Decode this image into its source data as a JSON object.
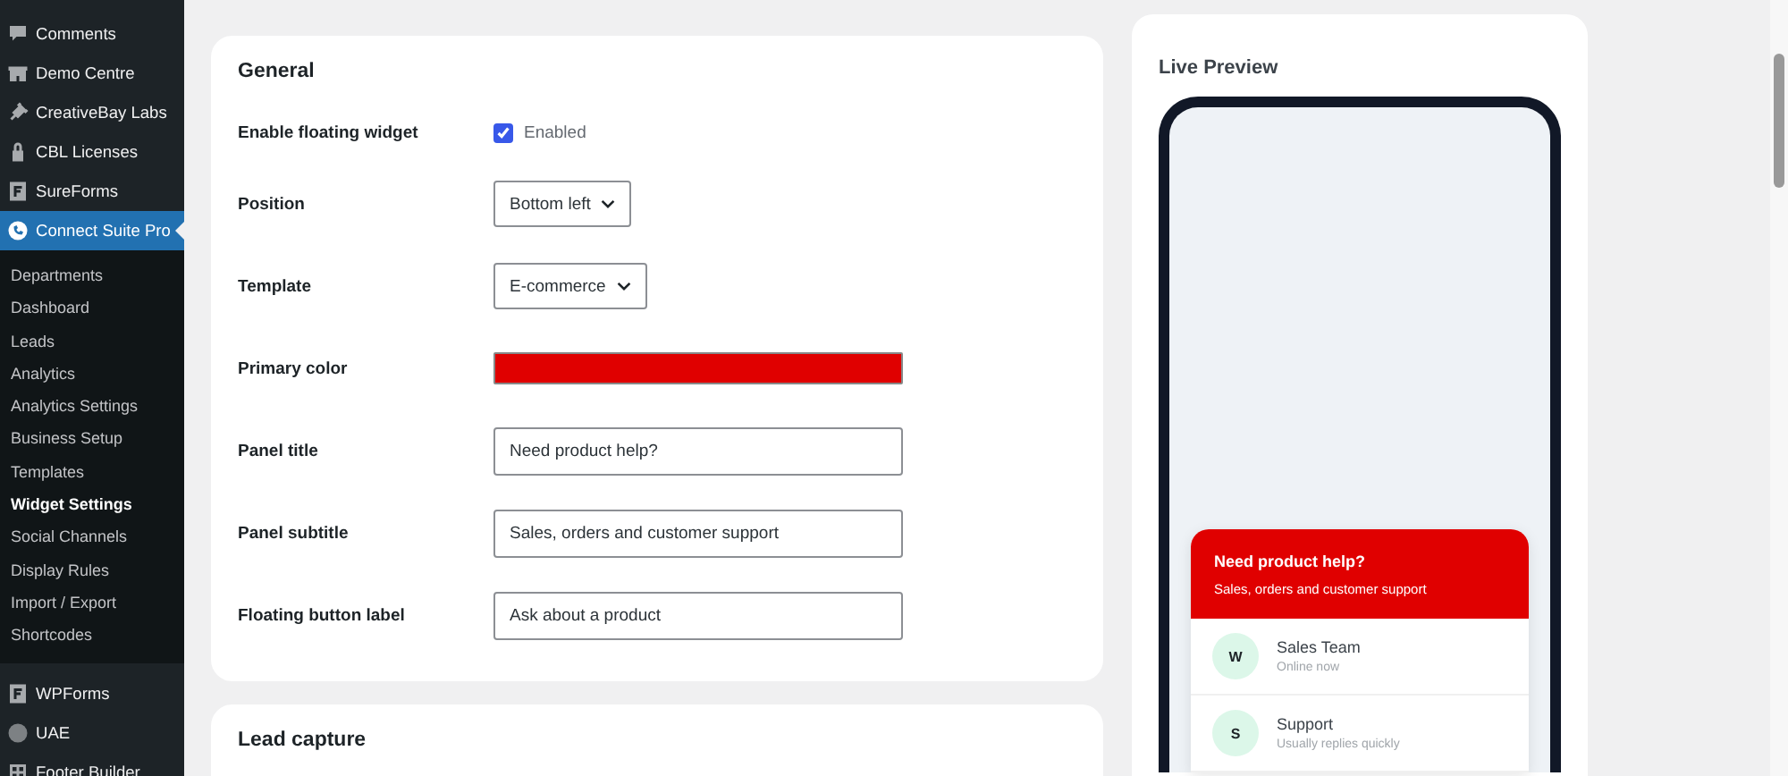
{
  "sidebar": {
    "items": [
      {
        "label": "Comments",
        "selected": false
      },
      {
        "label": "Demo Centre",
        "selected": false
      },
      {
        "label": "CreativeBay Labs",
        "selected": false
      },
      {
        "label": "CBL Licenses",
        "selected": false
      },
      {
        "label": "SureForms",
        "selected": false
      },
      {
        "label": "Connect Suite Pro",
        "selected": true,
        "children": [
          {
            "label": "Departments",
            "selected": false
          },
          {
            "label": "Dashboard",
            "selected": false
          },
          {
            "label": "Leads",
            "selected": false
          },
          {
            "label": "Analytics",
            "selected": false
          },
          {
            "label": "Analytics Settings",
            "selected": false
          },
          {
            "label": "Business Setup",
            "selected": false
          },
          {
            "label": "Templates",
            "selected": false
          },
          {
            "label": "Widget Settings",
            "selected": true
          },
          {
            "label": "Social Channels",
            "selected": false
          },
          {
            "label": "Display Rules",
            "selected": false
          },
          {
            "label": "Import / Export",
            "selected": false
          },
          {
            "label": "Shortcodes",
            "selected": false
          }
        ]
      },
      {
        "label": "WPForms",
        "selected": false
      },
      {
        "label": "UAE",
        "selected": false
      },
      {
        "label": "Footer Builder",
        "selected": false
      }
    ]
  },
  "general": {
    "title": "General",
    "fields": [
      {
        "kind": "checkbox",
        "label": "Enable floating widget",
        "value": "Enabled",
        "checked": true
      },
      {
        "kind": "select",
        "label": "Position",
        "value": "Bottom left"
      },
      {
        "kind": "select",
        "label": "Template",
        "value": "E-commerce"
      },
      {
        "kind": "color",
        "label": "Primary color",
        "color": "#e00000"
      },
      {
        "kind": "text",
        "label": "Panel title",
        "value": "Need product help?"
      },
      {
        "kind": "text",
        "label": "Panel subtitle",
        "value": "Sales, orders and customer support"
      },
      {
        "kind": "text",
        "label": "Floating button label",
        "value": "Ask about a product"
      }
    ]
  },
  "lead_capture": {
    "title": "Lead capture"
  },
  "live_preview": {
    "title": "Live Preview",
    "panel_title": "Need product help?",
    "panel_subtitle": "Sales, orders and customer support",
    "agents": [
      {
        "initial": "W",
        "name": "Sales Team",
        "status": "Online now"
      },
      {
        "initial": "S",
        "name": "Support",
        "status": "Usually replies quickly"
      }
    ]
  }
}
